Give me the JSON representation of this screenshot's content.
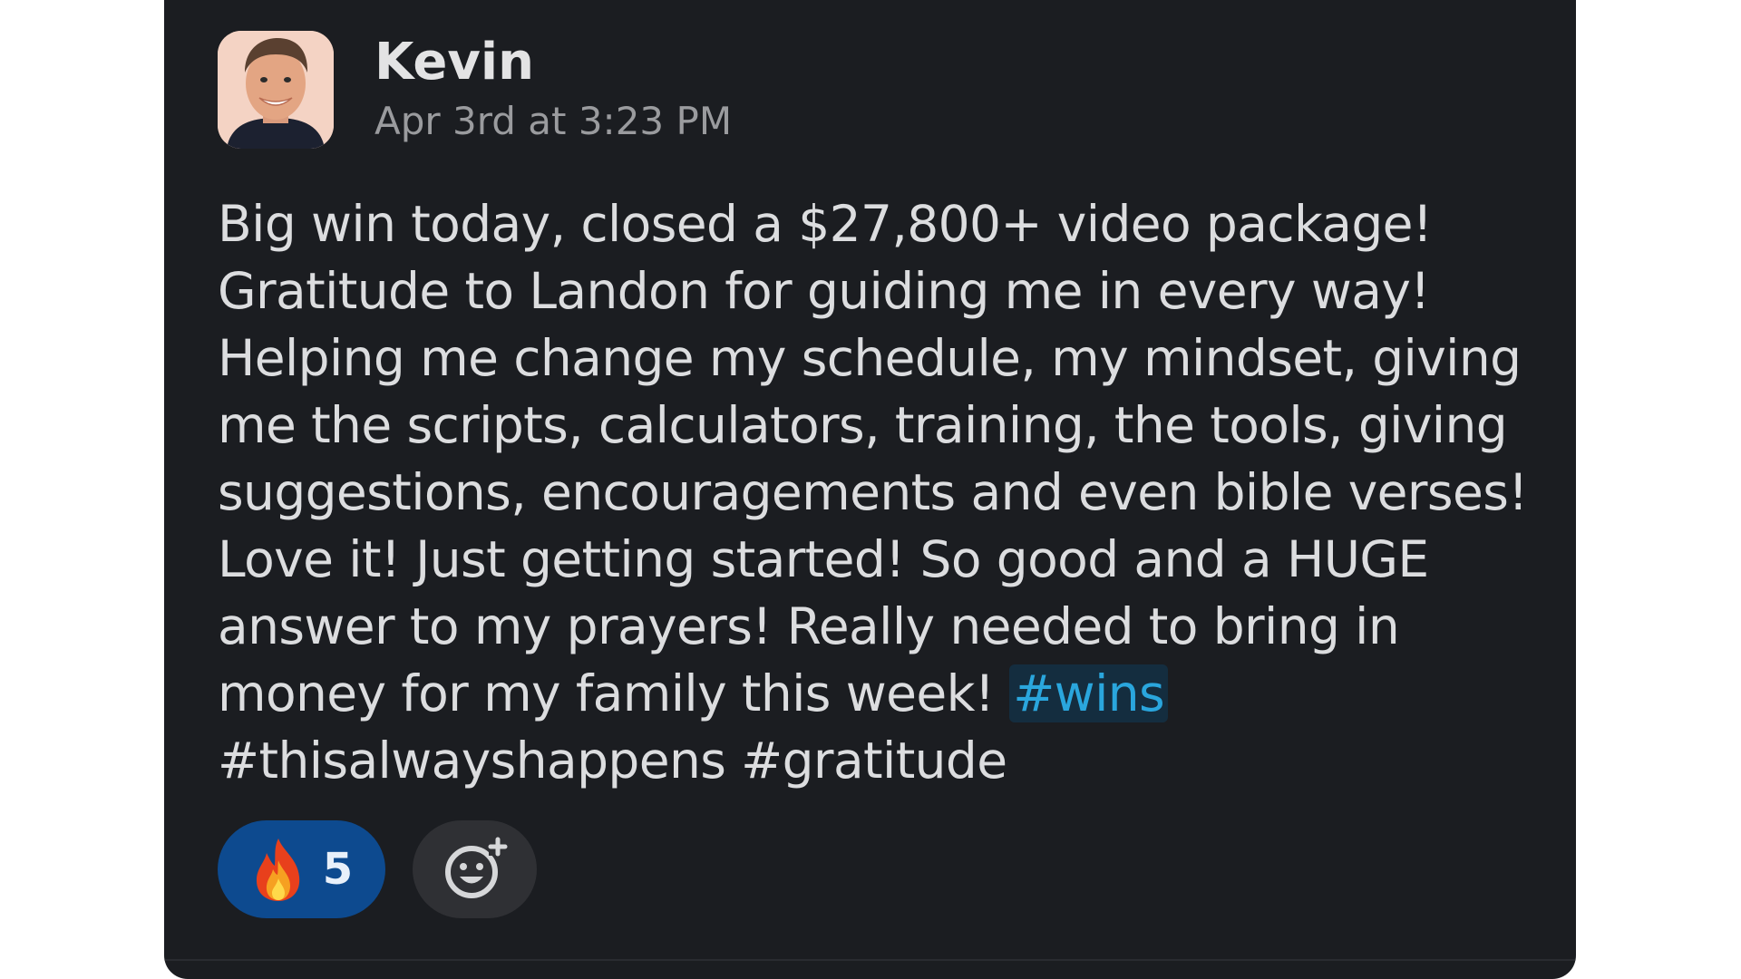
{
  "message": {
    "author": "Kevin",
    "timestamp": "Apr 3rd at 3:23 PM",
    "body_lines": [
      "Big win today, closed a $27,800+ video package!",
      "Gratitude to Landon for guiding me in every way!",
      "Helping me change my schedule, my mindset, giving",
      "me the scripts, calculators, training, the tools, giving",
      "suggestions, encouragements and even bible verses!",
      "Love it!  Just getting started! So good and a HUGE",
      "answer to my prayers! Really needed to bring in",
      "money for my family this week! "
    ],
    "hashtag_link": "#wins",
    "last_line": "#thisalwayshappens #gratitude"
  },
  "reactions": [
    {
      "emoji_icon": "fire-icon",
      "count": "5"
    }
  ],
  "add_reaction_icon": "add-reaction-icon",
  "colors": {
    "card_background": "#1b1d21",
    "reaction_active": "#0d4a8f",
    "link": "#2aa6dd",
    "link_highlight": "#142d3f"
  }
}
